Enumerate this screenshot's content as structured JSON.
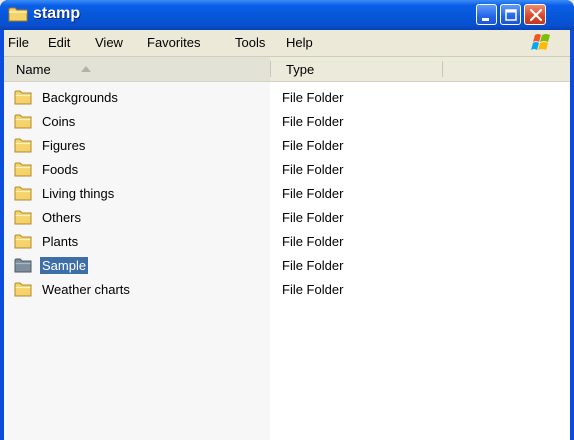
{
  "window": {
    "title": "stamp",
    "icon": "folder-icon",
    "controls": [
      "minimize-icon",
      "maximize-icon",
      "close-icon"
    ]
  },
  "menubar": {
    "items": [
      {
        "label": "File"
      },
      {
        "label": "Edit"
      },
      {
        "label": "View"
      },
      {
        "label": "Favorites"
      },
      {
        "label": "Tools"
      },
      {
        "label": "Help"
      }
    ],
    "logo": "windows-logo-icon"
  },
  "list": {
    "columns": [
      {
        "label": "Name",
        "sort": "ascending"
      },
      {
        "label": "Type"
      }
    ],
    "rows": [
      {
        "name": "Backgrounds",
        "type": "File Folder"
      },
      {
        "name": "Coins",
        "type": "File Folder"
      },
      {
        "name": "Figures",
        "type": "File Folder"
      },
      {
        "name": "Foods",
        "type": "File Folder"
      },
      {
        "name": "Living things",
        "type": "File Folder"
      },
      {
        "name": "Others",
        "type": "File Folder"
      },
      {
        "name": "Plants",
        "type": "File Folder"
      },
      {
        "name": "Sample",
        "type": "File Folder",
        "selected": true
      },
      {
        "name": "Weather charts",
        "type": "File Folder"
      }
    ]
  },
  "colors": {
    "titlebar": "#0557d7",
    "selection": "#3e6ea8",
    "folder": "#f5d26a"
  }
}
